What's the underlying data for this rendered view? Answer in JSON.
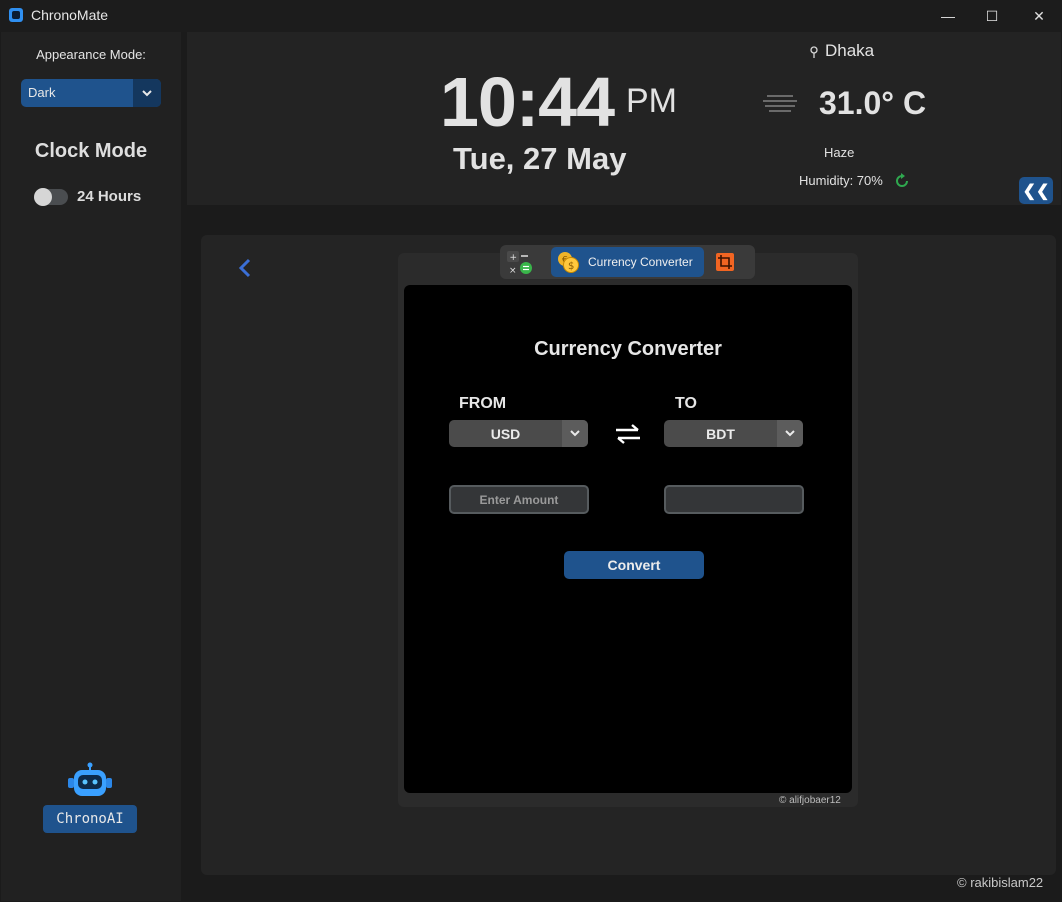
{
  "window": {
    "title": "ChronoMate",
    "controls": {
      "minimize": "—",
      "maximize": "☐",
      "close": "✕"
    }
  },
  "sidebar": {
    "appearance_label": "Appearance Mode:",
    "appearance_value": "Dark",
    "clock_mode_title": "Clock Mode",
    "hours_toggle_label": "24 Hours",
    "hours_toggle_on": false,
    "ai_button": "ChronoAI"
  },
  "header": {
    "time": "10:44",
    "ampm": "PM",
    "date": "Tue, 27 May",
    "city": "Dhaka",
    "temperature": "31.0° C",
    "condition": "Haze",
    "humidity": "Humidity: 70%",
    "collapse_icon": "❮❮"
  },
  "converter": {
    "tab_label": "Currency Converter",
    "title": "Currency Converter",
    "from_label": "FROM",
    "to_label": "TO",
    "from_currency": "USD",
    "to_currency": "BDT",
    "amount_placeholder": "Enter Amount",
    "result_value": "",
    "convert_label": "Convert",
    "inner_credit": "© alifjobaer12"
  },
  "footer": {
    "credit": "© rakibislam22"
  },
  "colors": {
    "accent": "#1f538d",
    "background": "#1b1b1b",
    "panel": "#242424",
    "content": "#000000",
    "refresh": "#2fa84f",
    "back_arrow": "#3b6fd6"
  },
  "icons": {
    "app": "app-icon",
    "location": "pin-icon",
    "weather": "haze-icon",
    "refresh": "refresh-icon",
    "calculator_tab": "calculator-icon",
    "currency_tab": "coins-icon",
    "crop_tab": "crop-icon",
    "swap": "swap-arrows-icon",
    "back": "chevron-left-icon",
    "assistant": "robot-icon"
  }
}
